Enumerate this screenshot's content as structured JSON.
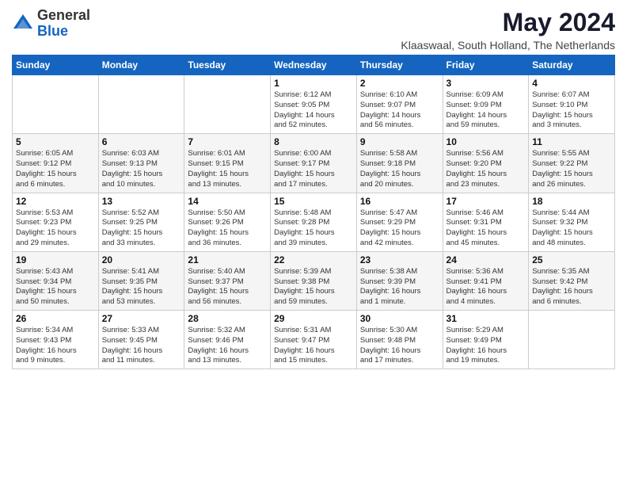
{
  "logo": {
    "line1": "General",
    "line2": "Blue"
  },
  "title": "May 2024",
  "subtitle": "Klaaswaal, South Holland, The Netherlands",
  "days_of_week": [
    "Sunday",
    "Monday",
    "Tuesday",
    "Wednesday",
    "Thursday",
    "Friday",
    "Saturday"
  ],
  "weeks": [
    [
      {
        "day": "",
        "info": ""
      },
      {
        "day": "",
        "info": ""
      },
      {
        "day": "",
        "info": ""
      },
      {
        "day": "1",
        "info": "Sunrise: 6:12 AM\nSunset: 9:05 PM\nDaylight: 14 hours\nand 52 minutes."
      },
      {
        "day": "2",
        "info": "Sunrise: 6:10 AM\nSunset: 9:07 PM\nDaylight: 14 hours\nand 56 minutes."
      },
      {
        "day": "3",
        "info": "Sunrise: 6:09 AM\nSunset: 9:09 PM\nDaylight: 14 hours\nand 59 minutes."
      },
      {
        "day": "4",
        "info": "Sunrise: 6:07 AM\nSunset: 9:10 PM\nDaylight: 15 hours\nand 3 minutes."
      }
    ],
    [
      {
        "day": "5",
        "info": "Sunrise: 6:05 AM\nSunset: 9:12 PM\nDaylight: 15 hours\nand 6 minutes."
      },
      {
        "day": "6",
        "info": "Sunrise: 6:03 AM\nSunset: 9:13 PM\nDaylight: 15 hours\nand 10 minutes."
      },
      {
        "day": "7",
        "info": "Sunrise: 6:01 AM\nSunset: 9:15 PM\nDaylight: 15 hours\nand 13 minutes."
      },
      {
        "day": "8",
        "info": "Sunrise: 6:00 AM\nSunset: 9:17 PM\nDaylight: 15 hours\nand 17 minutes."
      },
      {
        "day": "9",
        "info": "Sunrise: 5:58 AM\nSunset: 9:18 PM\nDaylight: 15 hours\nand 20 minutes."
      },
      {
        "day": "10",
        "info": "Sunrise: 5:56 AM\nSunset: 9:20 PM\nDaylight: 15 hours\nand 23 minutes."
      },
      {
        "day": "11",
        "info": "Sunrise: 5:55 AM\nSunset: 9:22 PM\nDaylight: 15 hours\nand 26 minutes."
      }
    ],
    [
      {
        "day": "12",
        "info": "Sunrise: 5:53 AM\nSunset: 9:23 PM\nDaylight: 15 hours\nand 29 minutes."
      },
      {
        "day": "13",
        "info": "Sunrise: 5:52 AM\nSunset: 9:25 PM\nDaylight: 15 hours\nand 33 minutes."
      },
      {
        "day": "14",
        "info": "Sunrise: 5:50 AM\nSunset: 9:26 PM\nDaylight: 15 hours\nand 36 minutes."
      },
      {
        "day": "15",
        "info": "Sunrise: 5:48 AM\nSunset: 9:28 PM\nDaylight: 15 hours\nand 39 minutes."
      },
      {
        "day": "16",
        "info": "Sunrise: 5:47 AM\nSunset: 9:29 PM\nDaylight: 15 hours\nand 42 minutes."
      },
      {
        "day": "17",
        "info": "Sunrise: 5:46 AM\nSunset: 9:31 PM\nDaylight: 15 hours\nand 45 minutes."
      },
      {
        "day": "18",
        "info": "Sunrise: 5:44 AM\nSunset: 9:32 PM\nDaylight: 15 hours\nand 48 minutes."
      }
    ],
    [
      {
        "day": "19",
        "info": "Sunrise: 5:43 AM\nSunset: 9:34 PM\nDaylight: 15 hours\nand 50 minutes."
      },
      {
        "day": "20",
        "info": "Sunrise: 5:41 AM\nSunset: 9:35 PM\nDaylight: 15 hours\nand 53 minutes."
      },
      {
        "day": "21",
        "info": "Sunrise: 5:40 AM\nSunset: 9:37 PM\nDaylight: 15 hours\nand 56 minutes."
      },
      {
        "day": "22",
        "info": "Sunrise: 5:39 AM\nSunset: 9:38 PM\nDaylight: 15 hours\nand 59 minutes."
      },
      {
        "day": "23",
        "info": "Sunrise: 5:38 AM\nSunset: 9:39 PM\nDaylight: 16 hours\nand 1 minute."
      },
      {
        "day": "24",
        "info": "Sunrise: 5:36 AM\nSunset: 9:41 PM\nDaylight: 16 hours\nand 4 minutes."
      },
      {
        "day": "25",
        "info": "Sunrise: 5:35 AM\nSunset: 9:42 PM\nDaylight: 16 hours\nand 6 minutes."
      }
    ],
    [
      {
        "day": "26",
        "info": "Sunrise: 5:34 AM\nSunset: 9:43 PM\nDaylight: 16 hours\nand 9 minutes."
      },
      {
        "day": "27",
        "info": "Sunrise: 5:33 AM\nSunset: 9:45 PM\nDaylight: 16 hours\nand 11 minutes."
      },
      {
        "day": "28",
        "info": "Sunrise: 5:32 AM\nSunset: 9:46 PM\nDaylight: 16 hours\nand 13 minutes."
      },
      {
        "day": "29",
        "info": "Sunrise: 5:31 AM\nSunset: 9:47 PM\nDaylight: 16 hours\nand 15 minutes."
      },
      {
        "day": "30",
        "info": "Sunrise: 5:30 AM\nSunset: 9:48 PM\nDaylight: 16 hours\nand 17 minutes."
      },
      {
        "day": "31",
        "info": "Sunrise: 5:29 AM\nSunset: 9:49 PM\nDaylight: 16 hours\nand 19 minutes."
      },
      {
        "day": "",
        "info": ""
      }
    ]
  ]
}
